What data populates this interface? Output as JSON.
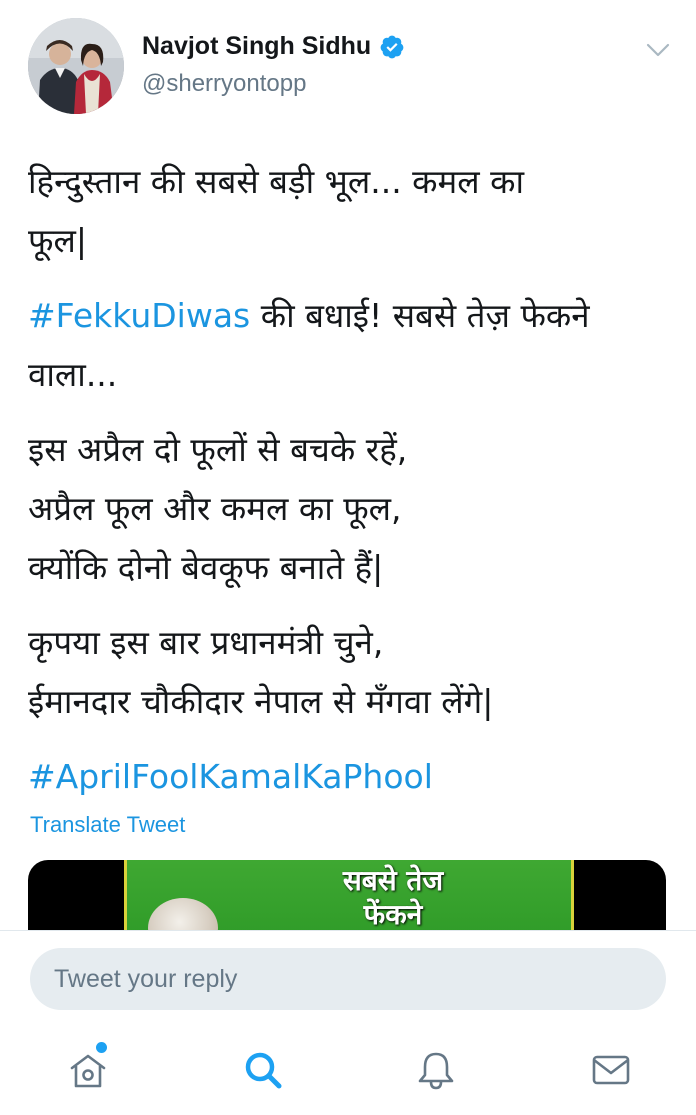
{
  "author": {
    "display_name": "Navjot Singh Sidhu",
    "handle": "@sherryontopp",
    "verified": true
  },
  "tweet": {
    "paragraphs": [
      {
        "lines": [
          {
            "parts": [
              {
                "text": "हिन्दुस्तान की सबसे बड़ी भूल... कमल का",
                "hashtag": false
              }
            ]
          },
          {
            "parts": [
              {
                "text": "फूल|",
                "hashtag": false
              }
            ]
          }
        ]
      },
      {
        "lines": [
          {
            "parts": [
              {
                "text": "#FekkuDiwas",
                "hashtag": true
              },
              {
                "text": " की बधाई! सबसे तेज़ फेकने",
                "hashtag": false
              }
            ]
          },
          {
            "parts": [
              {
                "text": "वाला...",
                "hashtag": false
              }
            ]
          }
        ]
      },
      {
        "lines": [
          {
            "parts": [
              {
                "text": "इस अप्रैल दो फूलों से बचके रहें,",
                "hashtag": false
              }
            ]
          },
          {
            "parts": [
              {
                "text": "अप्रैल फूल और कमल का फूल,",
                "hashtag": false
              }
            ]
          },
          {
            "parts": [
              {
                "text": "क्योंकि दोनो बेवकूफ बनाते हैं|",
                "hashtag": false
              }
            ]
          }
        ]
      },
      {
        "lines": [
          {
            "parts": [
              {
                "text": "कृपया इस बार प्रधानमंत्री चुने,",
                "hashtag": false
              }
            ]
          },
          {
            "parts": [
              {
                "text": "ईमानदार चौकीदार नेपाल से मँगवा लेंगे|",
                "hashtag": false
              }
            ]
          }
        ]
      },
      {
        "lines": [
          {
            "parts": [
              {
                "text": "#AprilFoolKamalKaPhool",
                "hashtag": true
              }
            ]
          }
        ]
      }
    ],
    "translate_label": "Translate Tweet"
  },
  "media": {
    "caption_line1": "सबसे तेज",
    "caption_line2": "फेंकने"
  },
  "reply": {
    "placeholder": "Tweet your reply"
  },
  "tabbar": {
    "items": [
      {
        "name": "home",
        "icon": "home-icon",
        "active": false,
        "has_dot": true
      },
      {
        "name": "search",
        "icon": "search-icon",
        "active": true
      },
      {
        "name": "notifications",
        "icon": "bell-icon",
        "active": false
      },
      {
        "name": "messages",
        "icon": "mail-icon",
        "active": false
      }
    ]
  },
  "colors": {
    "link": "#1b95e0",
    "accent": "#1da1f2",
    "secondary_text": "#657786",
    "reply_bg": "#e6ecf0"
  }
}
